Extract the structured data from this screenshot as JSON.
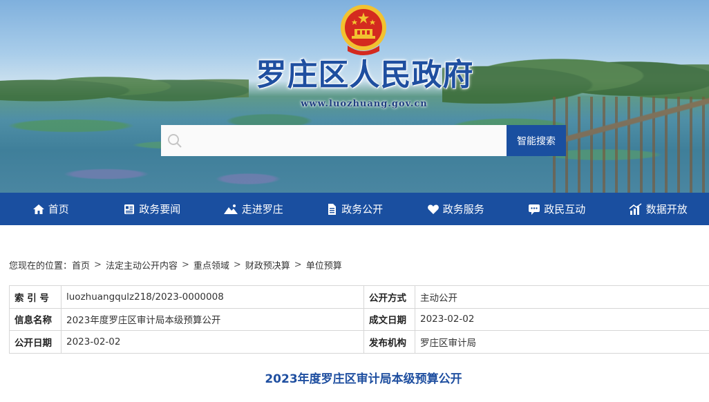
{
  "site": {
    "title": "罗庄区人民政府",
    "url": "www.luozhuang.gov.cn"
  },
  "search": {
    "placeholder": "",
    "button_label": "智能搜索"
  },
  "nav": {
    "items": [
      {
        "label": "首页",
        "icon": "home-icon"
      },
      {
        "label": "政务要闻",
        "icon": "news-icon"
      },
      {
        "label": "走进罗庄",
        "icon": "landscape-icon"
      },
      {
        "label": "政务公开",
        "icon": "document-icon"
      },
      {
        "label": "政务服务",
        "icon": "heart-icon"
      },
      {
        "label": "政民互动",
        "icon": "chat-icon"
      },
      {
        "label": "数据开放",
        "icon": "chart-icon"
      }
    ]
  },
  "breadcrumb": {
    "prefix": "您现在的位置：",
    "items": [
      "首页",
      "法定主动公开内容",
      "重点领域",
      "财政预决算",
      "单位预算"
    ],
    "separator": ">"
  },
  "info": {
    "index_label": "索 引 号",
    "index_value": "luozhuangqulz218/2023-0000008",
    "method_label": "公开方式",
    "method_value": "主动公开",
    "name_label": "信息名称",
    "name_value": "2023年度罗庄区审计局本级预算公开",
    "date_made_label": "成文日期",
    "date_made_value": "2023-02-02",
    "publish_date_label": "公开日期",
    "publish_date_value": "2023-02-02",
    "org_label": "发布机构",
    "org_value": "罗庄区审计局"
  },
  "article": {
    "title": "2023年度罗庄区审计局本级预算公开"
  },
  "colors": {
    "primary": "#1a4fa0",
    "title": "#1f4fa0",
    "emblem_red": "#d42a1f",
    "emblem_gold": "#f2c230"
  }
}
